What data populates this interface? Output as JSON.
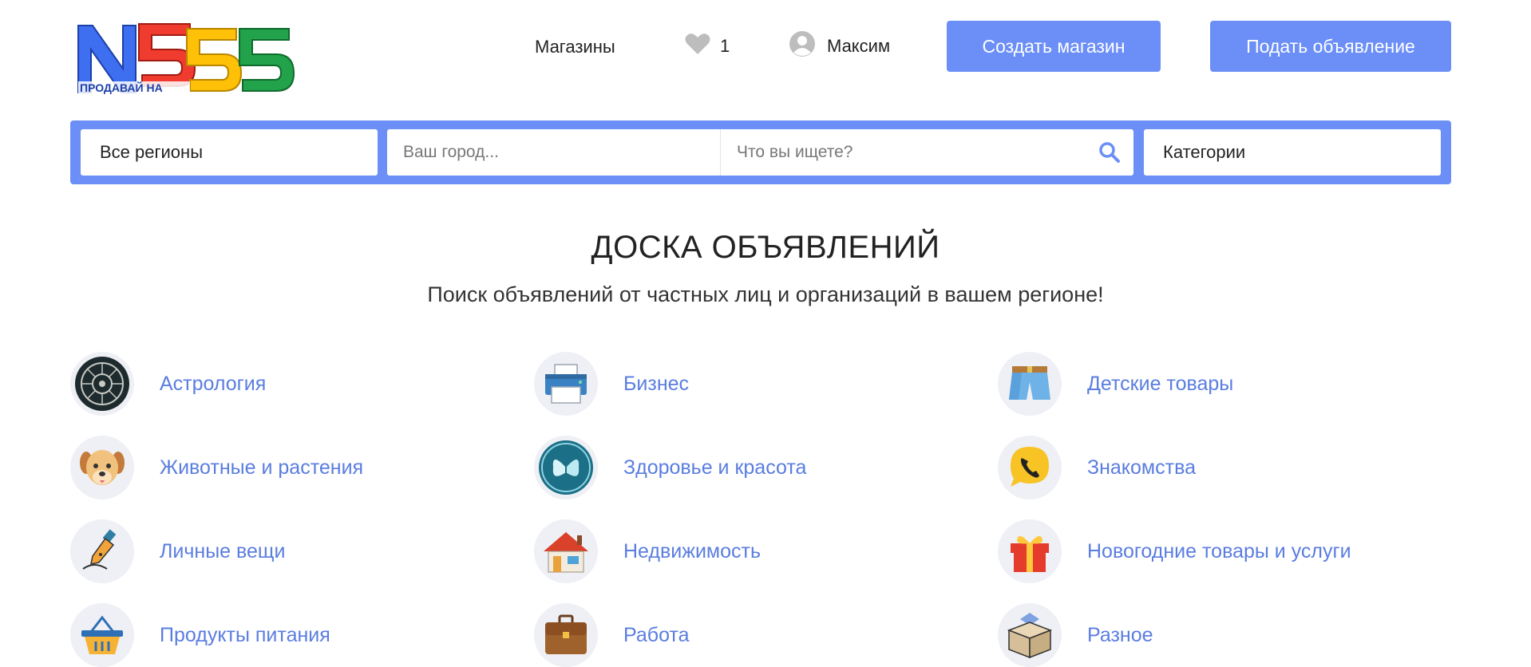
{
  "header": {
    "logo_tagline": "ПРОДАВАЙ НА",
    "logo_main": "N555",
    "nav_shops": "Магазины",
    "favorites_count": "1",
    "user_name": "Максим",
    "create_shop": "Создать магазин",
    "post_ad": "Подать объявление"
  },
  "search": {
    "region": "Все регионы",
    "city_placeholder": "Ваш город...",
    "query_placeholder": "Что вы ищете?",
    "categories": "Категории"
  },
  "main": {
    "title": "ДОСКА ОБЪЯВЛЕНИЙ",
    "subtitle": "Поиск объявлений от частных лиц и организаций в вашем регионе!"
  },
  "categories": [
    {
      "label": "Астрология",
      "icon": "zodiac-icon"
    },
    {
      "label": "Бизнес",
      "icon": "printer-icon"
    },
    {
      "label": "Детские товары",
      "icon": "shorts-icon"
    },
    {
      "label": "Животные и растения",
      "icon": "dog-icon"
    },
    {
      "label": "Здоровье и красота",
      "icon": "butterfly-icon"
    },
    {
      "label": "Знакомства",
      "icon": "phone-chat-icon"
    },
    {
      "label": "Личные вещи",
      "icon": "fountain-pen-icon"
    },
    {
      "label": "Недвижимость",
      "icon": "house-icon"
    },
    {
      "label": "Новогодние товары и услуги",
      "icon": "gift-icon"
    },
    {
      "label": "Продукты питания",
      "icon": "basket-icon"
    },
    {
      "label": "Работа",
      "icon": "briefcase-icon"
    },
    {
      "label": "Разное",
      "icon": "box-icon"
    }
  ],
  "colors": {
    "accent": "#6b8ff7",
    "link": "#5a7de0",
    "logo_blue": "#3d6ff0",
    "logo_red": "#f03c2e",
    "logo_yellow": "#ffc107",
    "logo_green": "#22a24a"
  }
}
